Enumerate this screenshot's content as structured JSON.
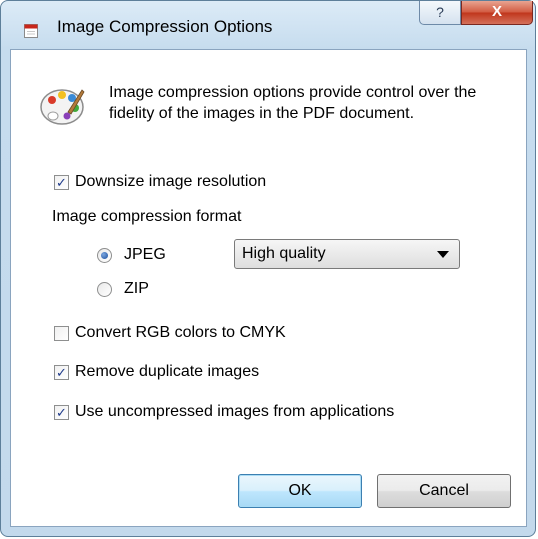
{
  "window": {
    "title": "Image Compression Options",
    "help_label": "?",
    "close_label": "X"
  },
  "intro_text": "Image compression options provide control over the fidelity of the images in the PDF document.",
  "options": {
    "downsize": {
      "label": "Downsize image resolution",
      "checked": true
    },
    "compression_format_label": "Image compression format",
    "jpeg": {
      "label": "JPEG",
      "selected": true
    },
    "zip": {
      "label": "ZIP",
      "selected": false
    },
    "quality_select": {
      "value": "High quality"
    },
    "convert_cmyk": {
      "label": "Convert RGB colors to CMYK",
      "checked": false
    },
    "remove_duplicates": {
      "label": "Remove duplicate images",
      "checked": true
    },
    "uncompressed": {
      "label": "Use uncompressed images from applications",
      "checked": true
    }
  },
  "buttons": {
    "ok": "OK",
    "cancel": "Cancel"
  },
  "check_glyph": "✓",
  "icons": [
    "pdf-app-icon",
    "palette-icon",
    "help-icon",
    "close-icon",
    "dropdown-arrow-icon"
  ]
}
